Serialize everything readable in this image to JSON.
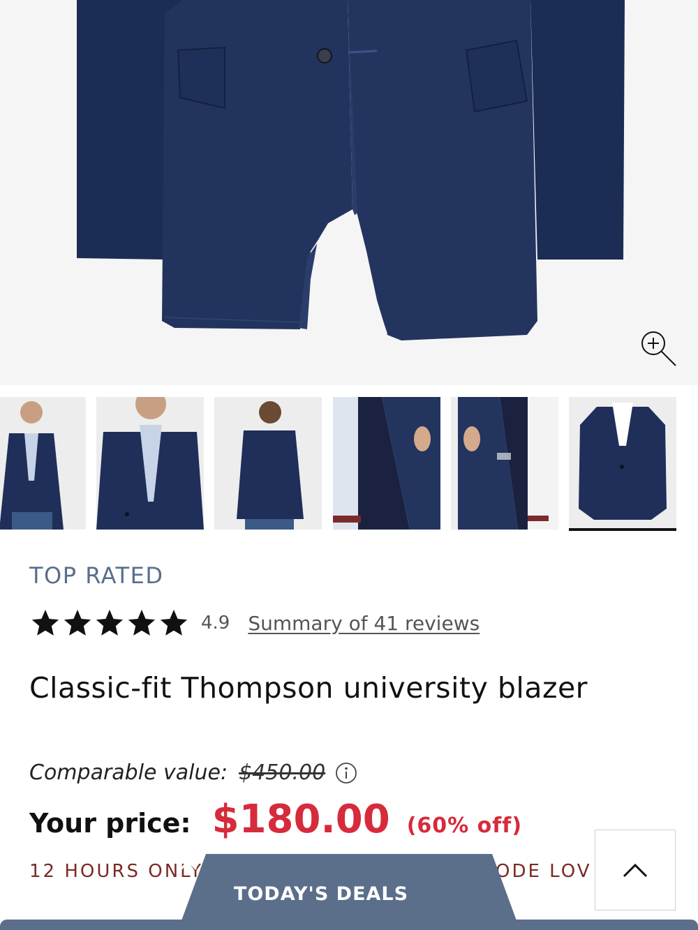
{
  "product": {
    "badge": "TOP RATED",
    "rating_value": "4.9",
    "rating_stars": 5,
    "reviews_link": "Summary of 41 reviews",
    "title": "Classic-fit Thompson university blazer",
    "comparable_label": "Comparable value:",
    "comparable_price": "$450.00",
    "your_price_label": "Your price:",
    "your_price": "$180.00",
    "discount": "(60% off)"
  },
  "gallery": {
    "thumbnails": [
      {
        "name": "front-model"
      },
      {
        "name": "detail-model"
      },
      {
        "name": "back-model"
      },
      {
        "name": "lining-left"
      },
      {
        "name": "lining-right"
      },
      {
        "name": "flat-lay",
        "selected": true
      }
    ]
  },
  "promo": {
    "left_text": "12 HOURS ONLY",
    "right_text": "ODE LOV"
  },
  "deals": {
    "label": "TODAY'S DEALS"
  },
  "colors": {
    "sale_red": "#d62b3b",
    "badge_blue": "#586e8c",
    "promo_brown": "#7a2a24",
    "deals_tab": "#5b6f8b",
    "navy": "#1b2a52"
  }
}
